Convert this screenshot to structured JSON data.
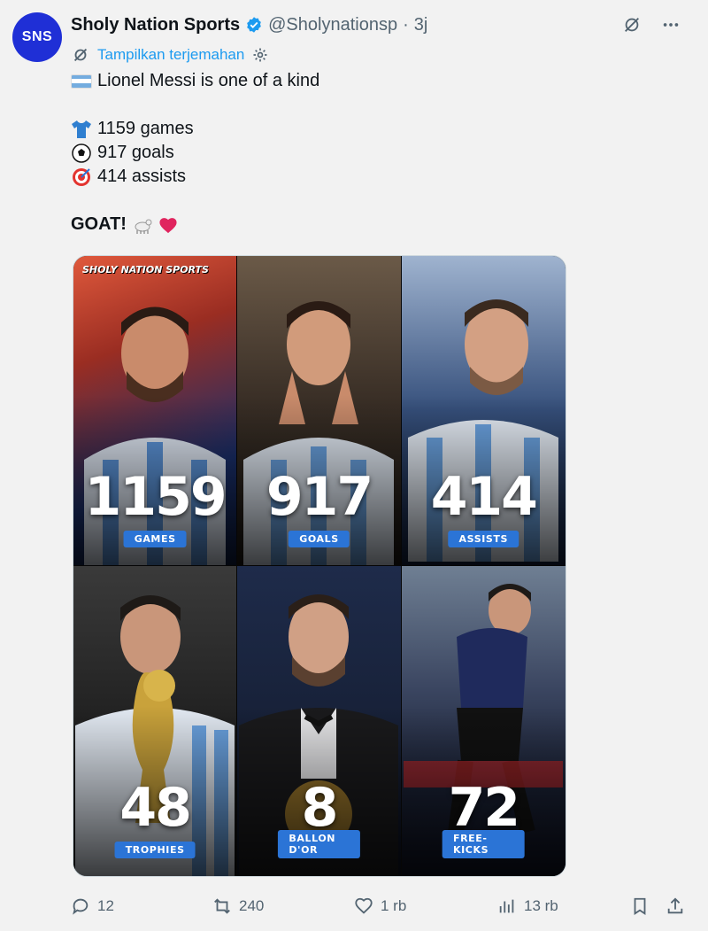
{
  "author": {
    "avatar_text": "SNS",
    "name": "Sholy Nation Sports",
    "handle": "@Sholynationsp",
    "separator": "·",
    "time": "3j"
  },
  "translate": {
    "label": "Tampilkan terjemahan"
  },
  "tweet": {
    "line1": "Lionel Messi is one of a kind",
    "games": "1159 games",
    "goals": "917 goals",
    "assists": "414 assists",
    "goat": "GOAT!"
  },
  "media": {
    "watermark": "SHOLY NATION SPORTS",
    "stats": [
      {
        "value": "1159",
        "label": "GAMES"
      },
      {
        "value": "917",
        "label": "GOALS"
      },
      {
        "value": "414",
        "label": "ASSISTS"
      },
      {
        "value": "48",
        "label": "TROPHIES"
      },
      {
        "value": "8",
        "label": "BALLON D'OR"
      },
      {
        "value": "72",
        "label": "FREE-KICKS"
      }
    ]
  },
  "actions": {
    "replies": "12",
    "reposts": "240",
    "likes": "1 rb",
    "views": "13 rb"
  },
  "colors": {
    "accent": "#1d9bf0",
    "avatar": "#1f2fd6",
    "label_bg": "#2b74d6"
  }
}
